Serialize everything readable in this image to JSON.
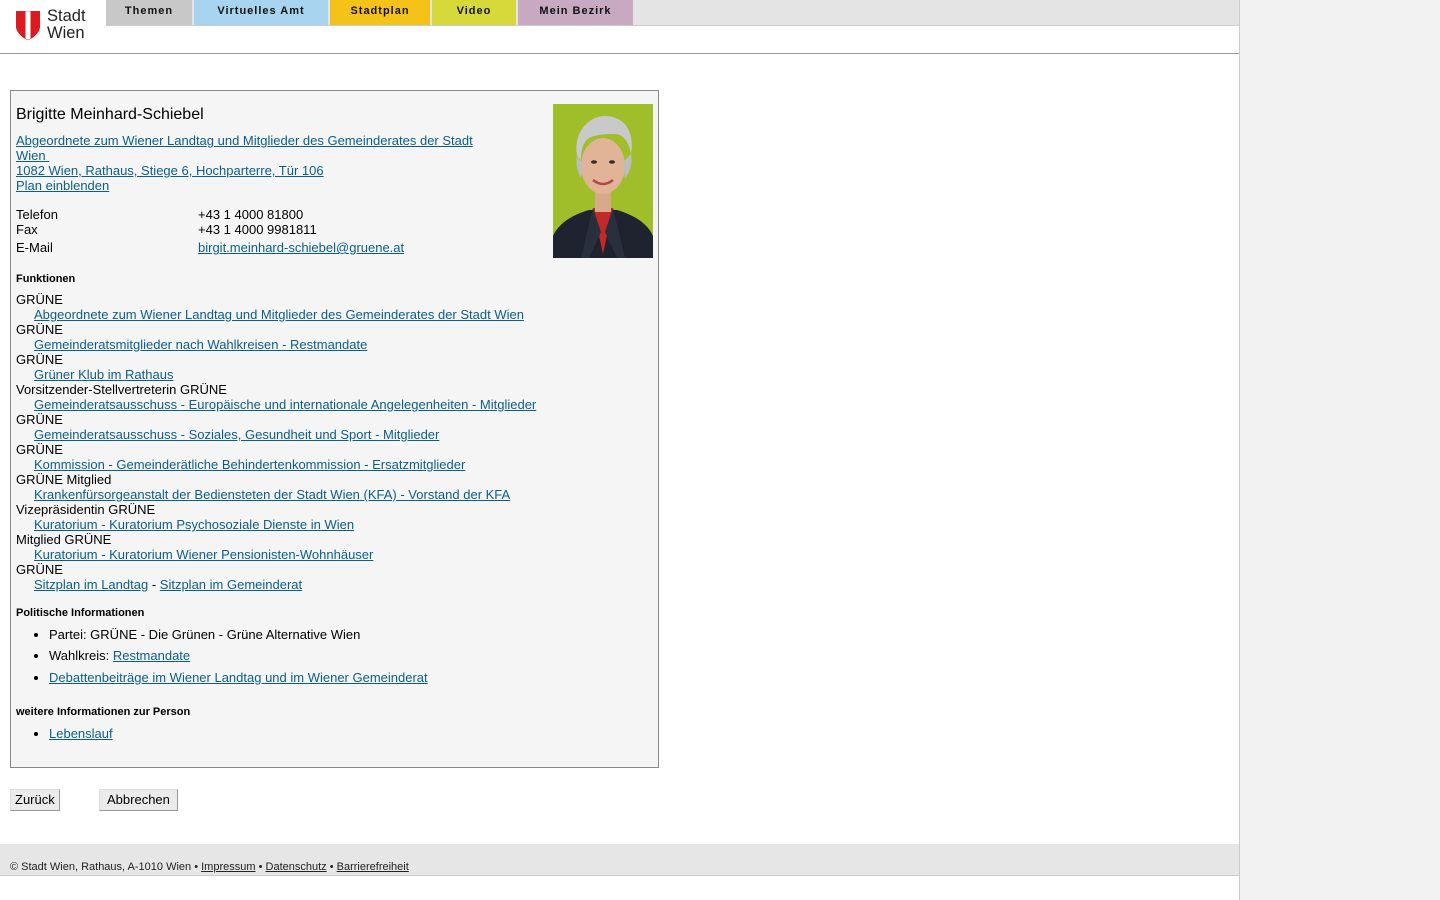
{
  "logo": {
    "line1": "Stadt",
    "line2": "Wien"
  },
  "nav": [
    {
      "label": "Themen",
      "color": "#c8c8c8"
    },
    {
      "label": "Virtuelles Amt",
      "color": "#a8d4f0"
    },
    {
      "label": "Stadtplan",
      "color": "#f5c21a"
    },
    {
      "label": "Video",
      "color": "#d7d93b"
    },
    {
      "label": "Mein Bezirk",
      "color": "#c7a9c1"
    }
  ],
  "person": {
    "name": "Brigitte Meinhard-Schiebel",
    "role_line1": "Abgeordnete zum Wiener Landtag und Mitglieder des Gemeinderates der Stadt",
    "role_line2": "Wien",
    "address": "1082 Wien, Rathaus, Stiege 6, Hochparterre, Tür 106",
    "map_link": "Plan einblenden"
  },
  "contact": {
    "phone_label": "Telefon",
    "phone": "+43 1 4000 81800",
    "fax_label": "Fax",
    "fax": "+43 1 4000 9981811",
    "email_label": "E-Mail",
    "email": "birgit.meinhard-schiebel@gruene.at"
  },
  "functions_title": "Funktionen",
  "functions": [
    {
      "role": "GRÜNE",
      "link": "Abgeordnete zum Wiener Landtag und Mitglieder des Gemeinderates der Stadt Wien"
    },
    {
      "role": "GRÜNE",
      "link": "Gemeinderatsmitglieder nach Wahlkreisen - Restmandate"
    },
    {
      "role": "GRÜNE",
      "link": "Grüner Klub im Rathaus"
    },
    {
      "role": "Vorsitzender-Stellvertreterin GRÜNE",
      "link": "Gemeinderatsausschuss - Europäische und internationale Angelegenheiten - Mitglieder"
    },
    {
      "role": "GRÜNE",
      "link": "Gemeinderatsausschuss - Soziales, Gesundheit und Sport - Mitglieder"
    },
    {
      "role": "GRÜNE",
      "link": "Kommission - Gemeinderätliche Behindertenkommission - Ersatzmitglieder"
    },
    {
      "role": "GRÜNE Mitglied",
      "link": "Krankenfürsorgeanstalt der Bediensteten der Stadt Wien (KFA) - Vorstand der KFA"
    },
    {
      "role": "Vizepräsidentin GRÜNE",
      "link": "Kuratorium - Kuratorium Psychosoziale Dienste in Wien"
    },
    {
      "role": "Mitglied GRÜNE",
      "link": "Kuratorium - Kuratorium Wiener Pensionisten-Wohnhäuser"
    }
  ],
  "last_role": "GRÜNE",
  "seat_link1": "Sitzplan im Landtag",
  "seat_sep": "-",
  "seat_link2": "Sitzplan im Gemeinderat",
  "political_title": "Politische Informationen",
  "party": "Partei: GRÜNE - Die Grünen - Grüne Alternative Wien",
  "district_label": "Wahlkreis:",
  "district_link": "Restmandate",
  "debates_link": "Debattenbeiträge im Wiener Landtag und im Wiener Gemeinderat",
  "more_title": "weitere Informationen zur Person",
  "cv_link": "Lebenslauf",
  "buttons": {
    "back": "Zurück",
    "cancel": "Abbrechen"
  },
  "footer": {
    "copyright": "© Stadt Wien, Rathaus, A-1010 Wien",
    "sep": "•",
    "impressum": "Impressum",
    "privacy": "Datenschutz",
    "accessibility": "Barrierefreiheit"
  },
  "colors": {
    "accent_red": "#dc1a22",
    "link": "#0b5d8f"
  }
}
